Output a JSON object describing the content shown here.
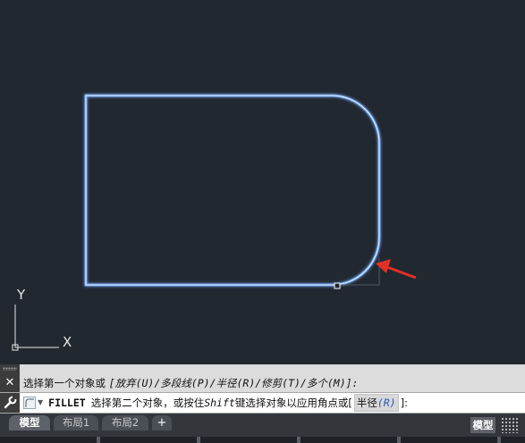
{
  "viewport": {
    "ucs": {
      "x_label": "X",
      "y_label": "Y"
    }
  },
  "command_history": {
    "prompt_text": "选择第一个对象或 ",
    "options_text": "[放弃(U)/多段线(P)/半径(R)/修剪(T)/多个(M)]:"
  },
  "command_line": {
    "command_name": "FILLET",
    "prompt_before_shift": "选择第二个对象，或按住 ",
    "shift_key": "Shift",
    "prompt_after_shift": " 键选择对象以应用角点或 ",
    "option_open": "[",
    "option_label": "半径",
    "option_key": "(R)",
    "option_close": "]:"
  },
  "layout_tabs": [
    {
      "label": "模型",
      "active": true
    },
    {
      "label": "布局1",
      "active": false
    },
    {
      "label": "布局2",
      "active": false
    }
  ],
  "add_tab_label": "+",
  "status_bar": {
    "model_label": "模型"
  },
  "colors": {
    "canvas_bg": "#212830",
    "highlight_outline": "#a6c8ff",
    "arrow": "#e0302a"
  }
}
